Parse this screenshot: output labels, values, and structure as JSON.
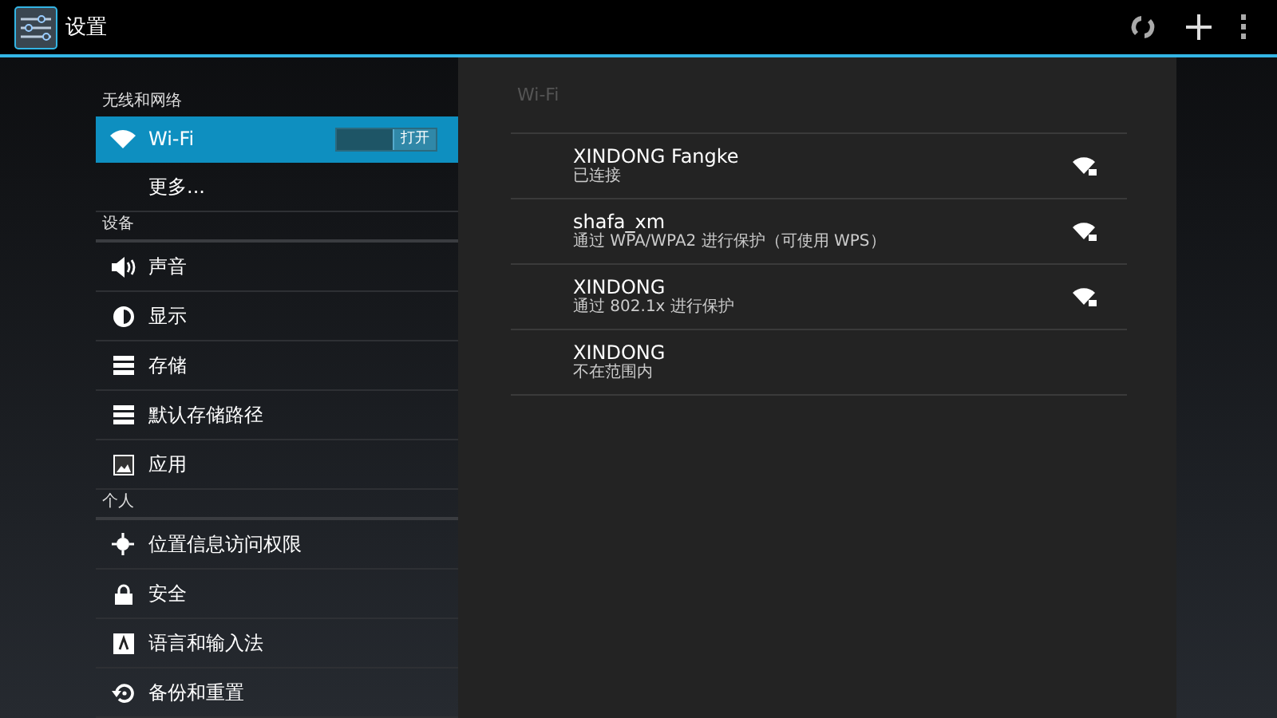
{
  "action_bar": {
    "title": "设置"
  },
  "sidebar": [
    {
      "kind": "header",
      "label": "无线和网络"
    },
    {
      "kind": "wifi",
      "label": "Wi-Fi",
      "selected": true,
      "toggle": {
        "label": "打开",
        "on": true
      }
    },
    {
      "kind": "plain",
      "label": "更多...",
      "selected": false
    },
    {
      "kind": "header",
      "label": "设备"
    },
    {
      "kind": "sound",
      "label": "声音",
      "selected": false
    },
    {
      "kind": "display",
      "label": "显示",
      "selected": false
    },
    {
      "kind": "storage",
      "label": "存储",
      "selected": false
    },
    {
      "kind": "storage",
      "label": "默认存储路径",
      "selected": false
    },
    {
      "kind": "apps",
      "label": "应用",
      "selected": false
    },
    {
      "kind": "header",
      "label": "个人"
    },
    {
      "kind": "location",
      "label": "位置信息访问权限",
      "selected": false
    },
    {
      "kind": "lock",
      "label": "安全",
      "selected": false
    },
    {
      "kind": "language",
      "label": "语言和输入法",
      "selected": false
    },
    {
      "kind": "backup",
      "label": "备份和重置",
      "selected": false
    }
  ],
  "wifi_panel": {
    "title": "Wi-Fi",
    "networks": [
      {
        "name": "XINDONG Fangke",
        "status": "已连接",
        "in_range": true
      },
      {
        "name": "shafa_xm",
        "status": "通过 WPA/WPA2 进行保护（可使用 WPS）",
        "in_range": true
      },
      {
        "name": "XINDONG",
        "status": "通过 802.1x 进行保护",
        "in_range": true
      },
      {
        "name": "XINDONG",
        "status": "不在范围内",
        "in_range": false
      }
    ]
  }
}
